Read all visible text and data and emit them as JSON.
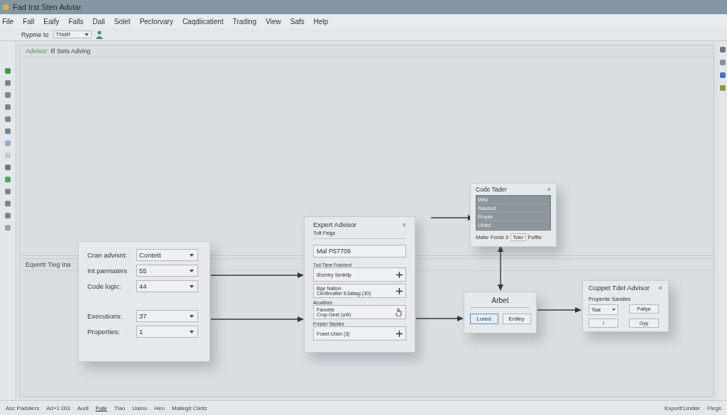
{
  "window": {
    "title": "Fad Irst Sten Adviar"
  },
  "menu": [
    "File",
    "Fall",
    "Eaify",
    "Falls",
    "Dali",
    "Solet",
    "Peclorvary",
    "Caqdiicatient",
    "Trading",
    "View",
    "Safs",
    "Help"
  ],
  "toolbar": {
    "label": "Rypme to",
    "value": "TNdR"
  },
  "left_toolbar": {
    "icons": [
      {
        "color": "#3f9a4a"
      },
      {
        "color": "#7d868c"
      },
      {
        "color": "#7d868c"
      },
      {
        "color": "#7d868c"
      },
      {
        "color": "#7d868c"
      },
      {
        "color": "#7d868c"
      },
      {
        "color": "#8fb0d0"
      },
      {
        "color": "#c4ccd2"
      },
      {
        "color": "#6f777c"
      },
      {
        "color": "#4fa55a"
      },
      {
        "color": "#7d868c"
      },
      {
        "color": "#7d868c"
      },
      {
        "color": "#7d868c"
      },
      {
        "color": "#9aa2a8"
      }
    ]
  },
  "right_toolbar": {
    "icons": [
      {
        "color": "#6f777c"
      },
      {
        "color": "#8a8f94"
      },
      {
        "color": "#3d78c0"
      },
      {
        "color": "#8a9a40"
      }
    ]
  },
  "top_panel": {
    "prefix": "Advisor:",
    "title": "Ill Sets Adving"
  },
  "bottom_panel": {
    "title": "Eqvertr Tieg Ina"
  },
  "form_dialog": {
    "rows": [
      {
        "label": "Cran advisnt:",
        "value": "Contett"
      },
      {
        "label": "Int parmaters",
        "value": "55"
      },
      {
        "label": "Code logic:",
        "value": "44"
      },
      {
        "label": "Executions:",
        "value": "37"
      },
      {
        "label": "Properties:",
        "value": "1"
      }
    ]
  },
  "expert_dialog": {
    "title": "Expert Advisor",
    "close": "×",
    "subtitle": "Tuft Pelgs",
    "field_value": "Mal P57709",
    "groups": [
      {
        "label": "Tud Tipre Fushient",
        "lines": [
          "IEcmtry Senkfip"
        ],
        "kind": "add"
      },
      {
        "lines": [
          "Bge Nation",
          "Cenfimatter E3atiag (30)"
        ],
        "kind": "add"
      },
      {
        "label": "Acuathes",
        "lines": [
          "Fanoble",
          "Crop Geet (ul4)"
        ],
        "kind": "hand"
      },
      {
        "label": "Frepler Sepiles",
        "lines": [
          "Foeet Uiser (3)"
        ],
        "kind": "add"
      }
    ]
  },
  "code_dialog": {
    "title": "Code Tader",
    "close": "×",
    "rows": [
      "Wtd",
      "Sautud",
      "Ruple",
      "Uldld"
    ],
    "footer": {
      "label_1": "Mafw",
      "label_2": "Fonst 3",
      "field": "Tsler",
      "label_3": "Fuffte"
    }
  },
  "arbet_dialog": {
    "title": "Arbet",
    "buttons": [
      {
        "label": "Lored",
        "selected": true
      },
      {
        "label": "Enfley",
        "selected": false
      }
    ]
  },
  "cuppet_dialog": {
    "title": "Cuppet Tdet Advisor",
    "close": "×",
    "label": "Propertie Sandies",
    "dropdown": "Taal",
    "buttons": [
      "Paflye",
      "/",
      "Gyy"
    ]
  },
  "status_bar": {
    "items": [
      {
        "label": "Asc Paddlers",
        "selected": false
      },
      {
        "label": "Ad+1 l3l3",
        "selected": false
      },
      {
        "label": "Audl",
        "selected": false
      },
      {
        "label": "Fute",
        "selected": true
      },
      {
        "label": "Tlao",
        "selected": false
      },
      {
        "label": "Uaino",
        "selected": false
      },
      {
        "label": "Hen",
        "selected": false
      },
      {
        "label": "Mallegit Cleltz",
        "selected": false
      }
    ],
    "right": [
      "Exportl'Lindler",
      "Flegs"
    ]
  }
}
